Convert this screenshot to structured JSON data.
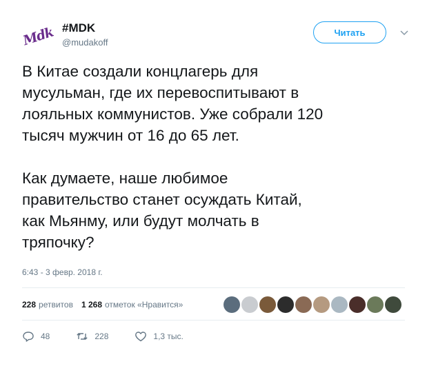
{
  "author": {
    "avatar_text": "Mdk",
    "display_name": "#MDK",
    "handle": "@mudakoff"
  },
  "follow_label": "Читать",
  "tweet": {
    "text": "В Китае создали концлагерь для\nмусульман, где их перевоспитывают в\nлояльных коммунистов. Уже собрали 120\nтысяч мужчин от 16 до 65 лет.\n\nКак думаете, наше любимое\nправительство станет осуждать Китай,\nкак Мьянму, или будут молчать в\nтряпочку?",
    "timestamp": "6:43 - 3 февр. 2018 г."
  },
  "stats": {
    "retweets_count": "228",
    "retweets_label": "ретвитов",
    "likes_count": "1 268",
    "likes_label": "отметок «Нравится»",
    "liker_avatar_colors": [
      "#5b6d7d",
      "#c9ccd0",
      "#7a5a3a",
      "#2c2c2c",
      "#8a6a55",
      "#b59a80",
      "#aab8c2",
      "#4a2e2a",
      "#6b7a5a",
      "#3f4a3c"
    ]
  },
  "actions": {
    "replies": "48",
    "retweets": "228",
    "likes": "1,3 тыс."
  },
  "colors": {
    "accent": "#1da1f2",
    "muted": "#657786",
    "text": "#14171a"
  }
}
